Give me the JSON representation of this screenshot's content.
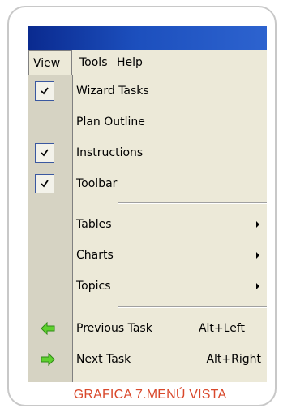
{
  "menubar": {
    "view": "View",
    "tools": "Tools",
    "help": "Help"
  },
  "menu": {
    "wizard_tasks": "Wizard Tasks",
    "plan_outline": "Plan Outline",
    "instructions": "Instructions",
    "toolbar": "Toolbar",
    "tables": "Tables",
    "charts": "Charts",
    "topics": "Topics",
    "previous_task": "Previous Task",
    "previous_task_shortcut": "Alt+Left",
    "next_task": "Next Task",
    "next_task_shortcut": "Alt+Right"
  },
  "checked": {
    "wizard_tasks": true,
    "instructions": true,
    "toolbar": true
  },
  "icons": {
    "check": "check-icon",
    "submenu": "submenu-arrow-icon",
    "previous": "green-left-arrow-icon",
    "next": "green-right-arrow-icon"
  },
  "colors": {
    "titlebar": "#0a2a8f",
    "menu_bg": "#ece9d8",
    "check_border": "#3a58a0",
    "nav_arrow": "#5fd12f",
    "caption": "#d9482b"
  },
  "caption": "GRAFICA 7.MENÚ VISTA"
}
